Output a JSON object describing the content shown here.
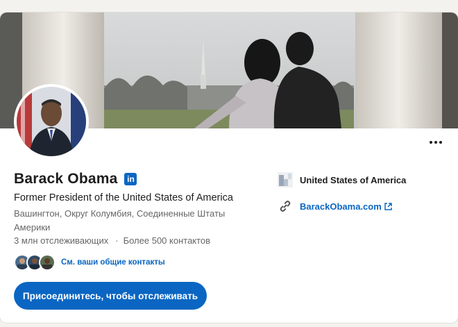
{
  "profile": {
    "name": "Barack Obama",
    "headline": "Former President of the United States of America",
    "location": "Вашингтон, Округ Колумбия, Соединенные Штаты Америки",
    "followers": "3 млн отслеживающих",
    "separator": "·",
    "connections": "Более 500 контактов",
    "mutual_link": "См. ваши общие контакты",
    "follow_button": "Присоединитесь, чтобы отслеживать",
    "linkedin_badge": "in"
  },
  "sidebar": {
    "organization": "United States of America",
    "website": "BarackObama.com"
  },
  "colors": {
    "accent": "#0a66c2",
    "text_primary": "#1d1d1d",
    "text_secondary": "#666666"
  },
  "icons": [
    "more-icon",
    "linkedin-icon",
    "organization-logo-icon",
    "link-icon",
    "external-link-icon"
  ]
}
